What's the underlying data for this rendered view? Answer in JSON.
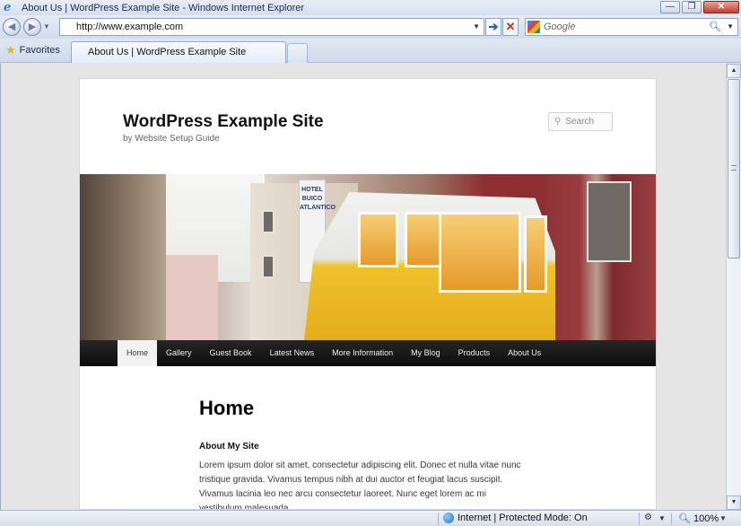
{
  "window": {
    "title": "About Us | WordPress Example Site - Windows Internet Explorer",
    "minimize": "—",
    "restore": "❐",
    "close": "✕"
  },
  "toolbar": {
    "back": "◀",
    "forward": "▶",
    "address": "http://www.example.com",
    "search_placeholder": "Google",
    "go_icon": "➔",
    "stop_icon": "✕"
  },
  "tabs": {
    "favorites_label": "Favorites",
    "active_tab": "About Us | WordPress Example Site"
  },
  "site": {
    "title": "WordPress Example Site",
    "description": "by Website Setup Guide",
    "search_placeholder": "Search",
    "header_sign": "HOTEL BUICO ATLANTICO"
  },
  "menu": [
    {
      "label": "Home",
      "active": true
    },
    {
      "label": "Gallery",
      "active": false
    },
    {
      "label": "Guest Book",
      "active": false
    },
    {
      "label": "Latest News",
      "active": false
    },
    {
      "label": "More Information",
      "active": false
    },
    {
      "label": "My Blog",
      "active": false
    },
    {
      "label": "Products",
      "active": false
    },
    {
      "label": "About Us",
      "active": false
    }
  ],
  "content": {
    "heading": "Home",
    "subheading": "About My Site",
    "paragraph": "Lorem ipsum dolor sit amet, consectetur adipiscing elit. Donec et nulla vitae nunc tristique gravida. Vivamus tempus nibh at dui auctor et feugiat lacus suscipit. Vivamus lacinia leo nec arcu consectetur laoreet. Nunc eget lorem ac mi vestibulum malesuada."
  },
  "statusbar": {
    "zone": "Internet | Protected Mode: On",
    "zoom": "100%"
  },
  "icons": {
    "ie_logo": "ie-logo-icon",
    "favorites_star": "star-icon",
    "google_logo": "google-icon",
    "search": "search-icon",
    "globe": "globe-icon"
  },
  "colors": {
    "menu_bg": "#1a1a1a",
    "menu_active_bg": "#f2f2f2",
    "tram_yellow": "#f0c22e"
  }
}
